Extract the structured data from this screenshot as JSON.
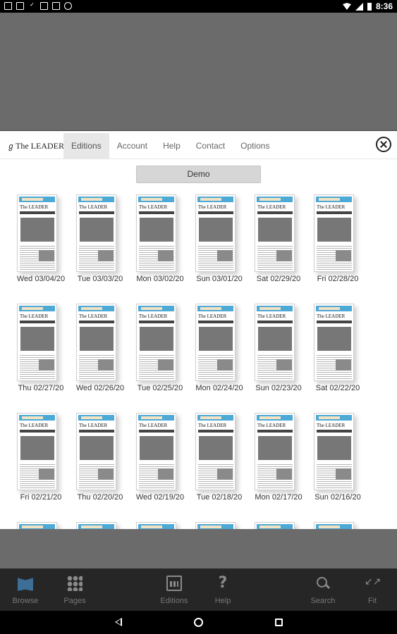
{
  "status_bar": {
    "time": "8:36"
  },
  "menu": {
    "logo": "The LEADER",
    "items": [
      {
        "label": "Editions",
        "active": true
      },
      {
        "label": "Account"
      },
      {
        "label": "Help"
      },
      {
        "label": "Contact"
      },
      {
        "label": "Options"
      }
    ]
  },
  "demo_button": "Demo",
  "editions": [
    {
      "label": "Wed 03/04/20"
    },
    {
      "label": "Tue 03/03/20"
    },
    {
      "label": "Mon 03/02/20"
    },
    {
      "label": "Sun 03/01/20"
    },
    {
      "label": "Sat 02/29/20"
    },
    {
      "label": "Fri 02/28/20"
    },
    {
      "label": "Thu 02/27/20"
    },
    {
      "label": "Wed 02/26/20"
    },
    {
      "label": "Tue 02/25/20"
    },
    {
      "label": "Mon 02/24/20"
    },
    {
      "label": "Sun 02/23/20"
    },
    {
      "label": "Sat 02/22/20"
    },
    {
      "label": "Fri 02/21/20"
    },
    {
      "label": "Thu 02/20/20"
    },
    {
      "label": "Wed 02/19/20"
    },
    {
      "label": "Tue 02/18/20"
    },
    {
      "label": "Mon 02/17/20"
    },
    {
      "label": "Sun 02/16/20"
    }
  ],
  "bottom_nav": [
    {
      "label": "Browse",
      "icon": "book-icon",
      "active": true
    },
    {
      "label": "Pages",
      "icon": "grid-icon"
    },
    {
      "label": "Editions",
      "icon": "calendar-icon"
    },
    {
      "label": "Help",
      "icon": "help-icon"
    },
    {
      "label": "Search",
      "icon": "search-icon"
    },
    {
      "label": "Fit",
      "icon": "fit-icon"
    }
  ],
  "colors": {
    "accent": "#4da9d6",
    "nav_bg": "#262626",
    "backdrop": "#6b6b6b"
  }
}
